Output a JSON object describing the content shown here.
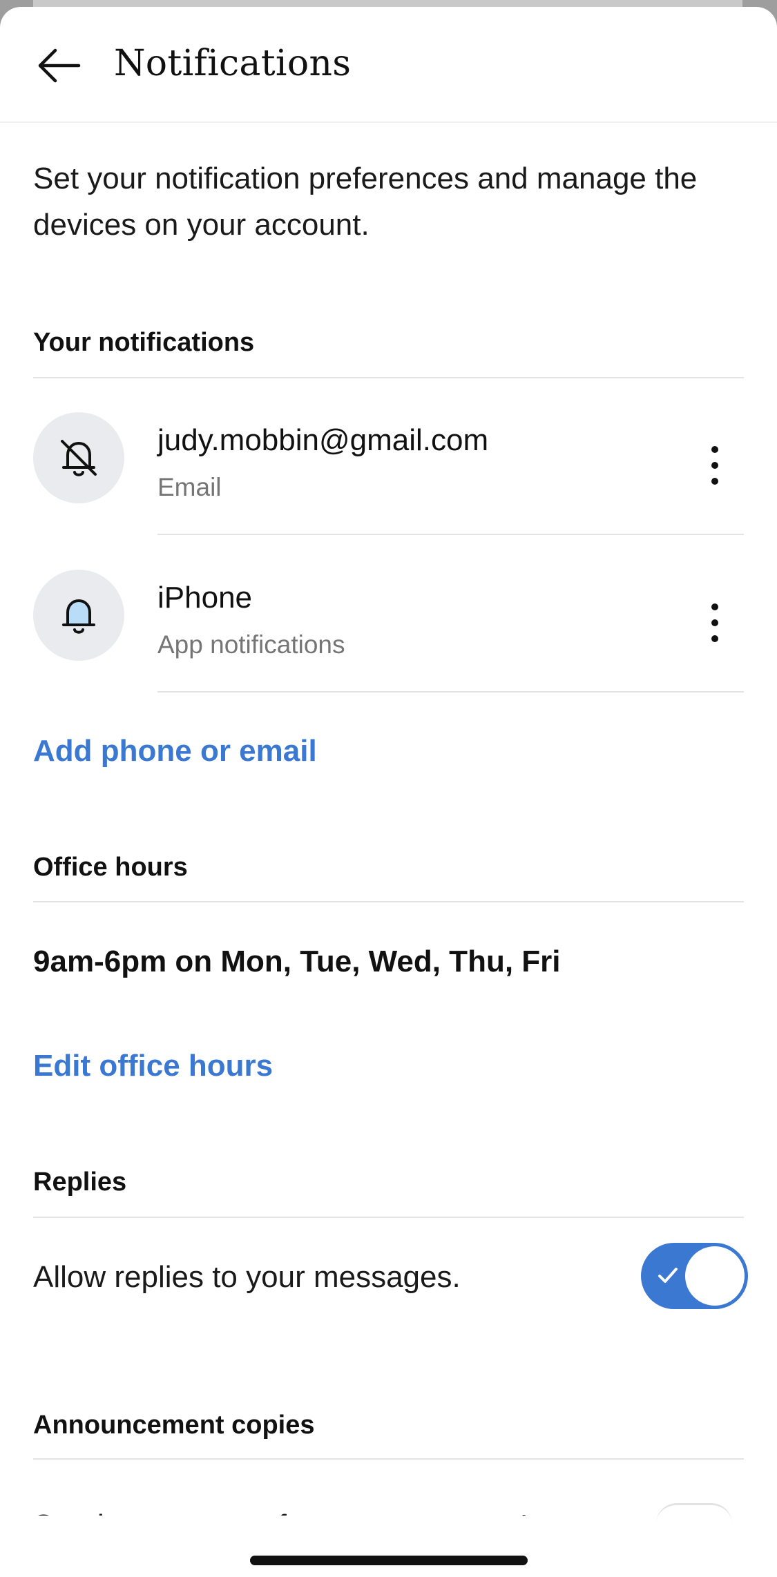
{
  "header": {
    "title": "Notifications"
  },
  "intro": "Set your notification preferences and manage the devices on your account.",
  "your_notifications": {
    "title": "Your notifications",
    "items": [
      {
        "title": "judy.mobbin@gmail.com",
        "subtitle": "Email",
        "icon": "bell-off-icon"
      },
      {
        "title": "iPhone",
        "subtitle": "App notifications",
        "icon": "bell-icon"
      }
    ],
    "add_link": "Add phone or email"
  },
  "office_hours": {
    "title": "Office hours",
    "value": "9am-6pm on Mon, Tue, Wed, Thu, Fri",
    "edit_link": "Edit office hours"
  },
  "replies": {
    "title": "Replies",
    "label": "Allow replies to your messages.",
    "enabled": true
  },
  "announcement_copies": {
    "title": "Announcement copies",
    "label": "Send me a copy of announcements I post"
  },
  "colors": {
    "accent": "#3a78d2",
    "icon_bg": "#e9ebee",
    "bell_fill": "#b9dcf7"
  }
}
